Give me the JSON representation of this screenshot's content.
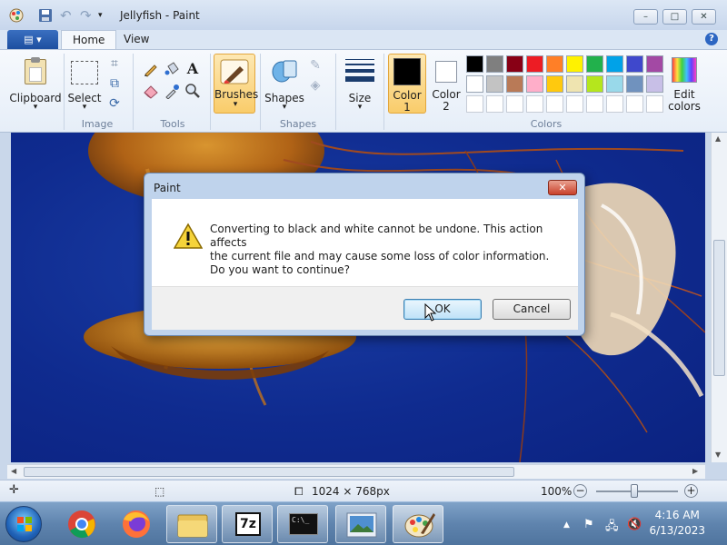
{
  "window": {
    "title": "Jellyfish - Paint",
    "minimize": "–",
    "maximize": "□",
    "close": "✕"
  },
  "tabs": {
    "app_menu": "▤ ▾",
    "home": "Home",
    "view": "View",
    "help": "?"
  },
  "ribbon": {
    "clipboard": {
      "button": "Clipboard",
      "arrow": "▾"
    },
    "image": {
      "select": "Select",
      "arrow": "▾",
      "group": "Image"
    },
    "tools": {
      "group": "Tools"
    },
    "brushes": {
      "label": "Brushes",
      "arrow": "▾"
    },
    "shapes": {
      "label": "Shapes",
      "arrow": "▾",
      "group": "Shapes"
    },
    "size": {
      "label": "Size",
      "arrow": "▾"
    },
    "color1": {
      "label": "Color",
      "num": "1"
    },
    "color2": {
      "label": "Color",
      "num": "2"
    },
    "colors_group": "Colors",
    "edit_colors": {
      "line1": "Edit",
      "line2": "colors"
    },
    "palette_row1": [
      "#000000",
      "#7f7f7f",
      "#880015",
      "#ed1c24",
      "#ff7f27",
      "#fff200",
      "#22b14c",
      "#00a2e8",
      "#3f48cc",
      "#a349a4"
    ],
    "palette_row2": [
      "#ffffff",
      "#c3c3c3",
      "#b97a57",
      "#ffaec9",
      "#ffc90e",
      "#efe4b0",
      "#b5e61d",
      "#99d9ea",
      "#7092be",
      "#c8bfe7"
    ]
  },
  "status": {
    "dimensions": "1024 × 768px",
    "zoom": "100%"
  },
  "dialog": {
    "title": "Paint",
    "close": "✕",
    "line1": "Converting to black and white cannot be undone.  This action affects",
    "line2": "the current file and may cause some loss of color information.",
    "line3": "Do you want to continue?",
    "ok": "OK",
    "cancel": "Cancel"
  },
  "taskbar": {
    "time": "4:16 AM",
    "date": "6/13/2023",
    "sevenzip": "7z",
    "cmd": "C:\\_"
  }
}
